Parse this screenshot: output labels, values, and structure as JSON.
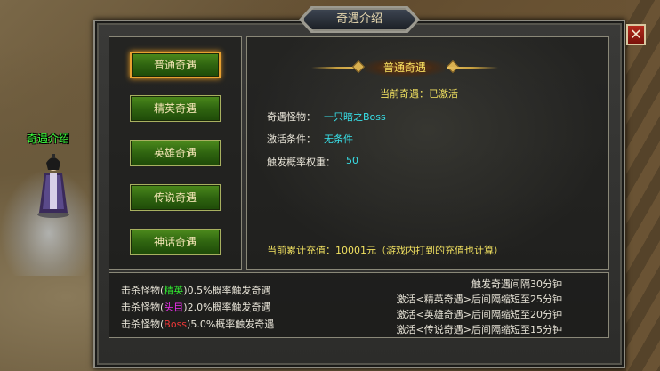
{
  "scene": {
    "npc_name": "奇遇介绍"
  },
  "window": {
    "title": "奇遇介绍",
    "close_label": "✕"
  },
  "encounter_buttons": [
    {
      "label": "普通奇遇",
      "active": true
    },
    {
      "label": "精英奇遇",
      "active": false
    },
    {
      "label": "英雄奇遇",
      "active": false
    },
    {
      "label": "传说奇遇",
      "active": false
    },
    {
      "label": "神话奇遇",
      "active": false
    }
  ],
  "detail": {
    "header": "普通奇遇",
    "current_status": "当前奇遇：已激活",
    "monster_label": "奇遇怪物：",
    "monster_value": "一只暗之Boss",
    "condition_label": "激活条件：",
    "condition_value": "无条件",
    "weight_label": "触发概率权重：",
    "weight_value": "50",
    "recharge_text": "当前累计充值：10001元（游戏内打到的充值也计算）"
  },
  "kill_rules": [
    {
      "prefix": "击杀怪物(",
      "tag": "精英",
      "suffix": ")0.5%概率触发奇遇",
      "tag_color": "#30e830"
    },
    {
      "prefix": "击杀怪物(",
      "tag": "头目",
      "suffix": ")2.0%概率触发奇遇",
      "tag_color": "#f030f0"
    },
    {
      "prefix": "击杀怪物(",
      "tag": "Boss",
      "suffix": ")5.0%概率触发奇遇",
      "tag_color": "#f03838"
    }
  ],
  "interval_rules": [
    "触发奇遇间隔30分钟",
    "激活<精英奇遇>后间隔缩短至25分钟",
    "激活<英雄奇遇>后间隔缩短至20分钟",
    "激活<传说奇遇>后间隔缩短至15分钟"
  ]
}
